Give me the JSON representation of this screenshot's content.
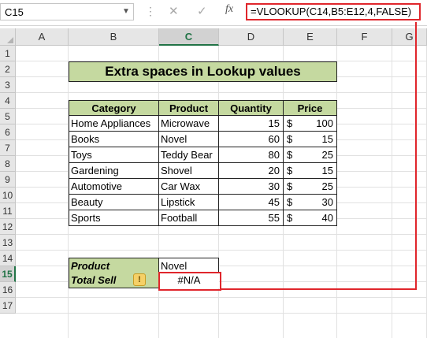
{
  "formula_bar": {
    "name_box": "C15",
    "cancel_icon": "✕",
    "enter_icon": "✓",
    "fx_label": "fx",
    "formula": "=VLOOKUP(C14,B5:E12,4,FALSE)"
  },
  "columns": [
    "A",
    "B",
    "C",
    "D",
    "E",
    "F",
    "G"
  ],
  "rows": [
    "1",
    "2",
    "3",
    "4",
    "5",
    "6",
    "7",
    "8",
    "9",
    "10",
    "11",
    "12",
    "13",
    "14",
    "15",
    "16",
    "17"
  ],
  "title": "Extra spaces in Lookup values",
  "table": {
    "headers": [
      "Category",
      "Product",
      "Quantity",
      "Price"
    ],
    "currency": "$",
    "rows": [
      {
        "category": "Home Appliances",
        "product": "Microwave",
        "quantity": "15",
        "price": "100"
      },
      {
        "category": "Books",
        "product": "Novel",
        "quantity": "60",
        "price": "15"
      },
      {
        "category": "Toys",
        "product": "Teddy Bear",
        "quantity": "80",
        "price": "25"
      },
      {
        "category": "Gardening",
        "product": "Shovel",
        "quantity": "20",
        "price": "15"
      },
      {
        "category": "Automotive",
        "product": "Car Wax",
        "quantity": "30",
        "price": "25"
      },
      {
        "category": "Beauty",
        "product": "Lipstick",
        "quantity": "45",
        "price": "30"
      },
      {
        "category": "Sports",
        "product": "Football",
        "quantity": "55",
        "price": "40"
      }
    ]
  },
  "lookup": {
    "product_label": "Product",
    "product_value": "Novel",
    "total_label": "Total Sell",
    "result": "#N/A",
    "warning_icon": "!"
  },
  "colors": {
    "header_fill": "#c5d9a0",
    "highlight": "#e0262c",
    "selection": "#217346"
  }
}
